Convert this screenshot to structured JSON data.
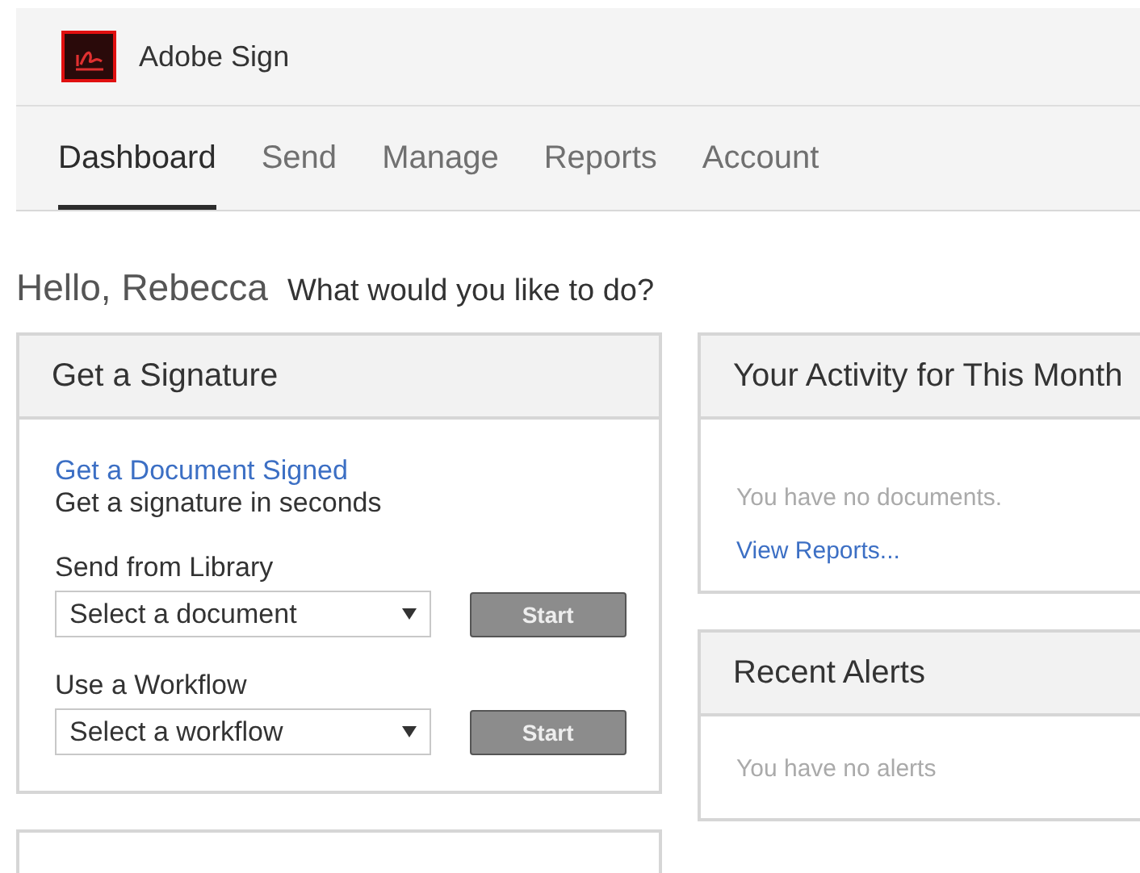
{
  "app": {
    "name": "Adobe Sign"
  },
  "nav": [
    {
      "label": "Dashboard",
      "selected": true
    },
    {
      "label": "Send",
      "selected": false
    },
    {
      "label": "Manage",
      "selected": false
    },
    {
      "label": "Reports",
      "selected": false
    },
    {
      "label": "Account",
      "selected": false
    }
  ],
  "greeting": {
    "name": "Hello, Rebecca",
    "prompt": "What would you like to do?"
  },
  "signature_card": {
    "title": "Get a Signature",
    "link": "Get a Document Signed",
    "subtitle": "Get a signature in seconds",
    "sections": [
      {
        "label": "Send from Library",
        "placeholder": "Select a document",
        "button": "Start"
      },
      {
        "label": "Use a Workflow",
        "placeholder": "Select a workflow",
        "button": "Start"
      }
    ]
  },
  "activity_card": {
    "title": "Your Activity for This Month",
    "message": "You have no documents.",
    "link": "View Reports..."
  },
  "alerts_card": {
    "title": "Recent Alerts",
    "message": "You have no alerts"
  }
}
